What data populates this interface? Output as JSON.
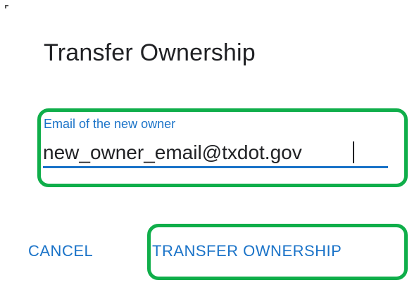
{
  "dialog": {
    "title": "Transfer Ownership"
  },
  "email_field": {
    "label": "Email of the new owner",
    "value": "new_owner_email@txdot.gov"
  },
  "actions": {
    "cancel_label": "CANCEL",
    "transfer_label": "TRANSFER OWNERSHIP"
  },
  "colors": {
    "accent": "#1a73c8",
    "highlight": "#0fae4a",
    "text": "#202124"
  }
}
